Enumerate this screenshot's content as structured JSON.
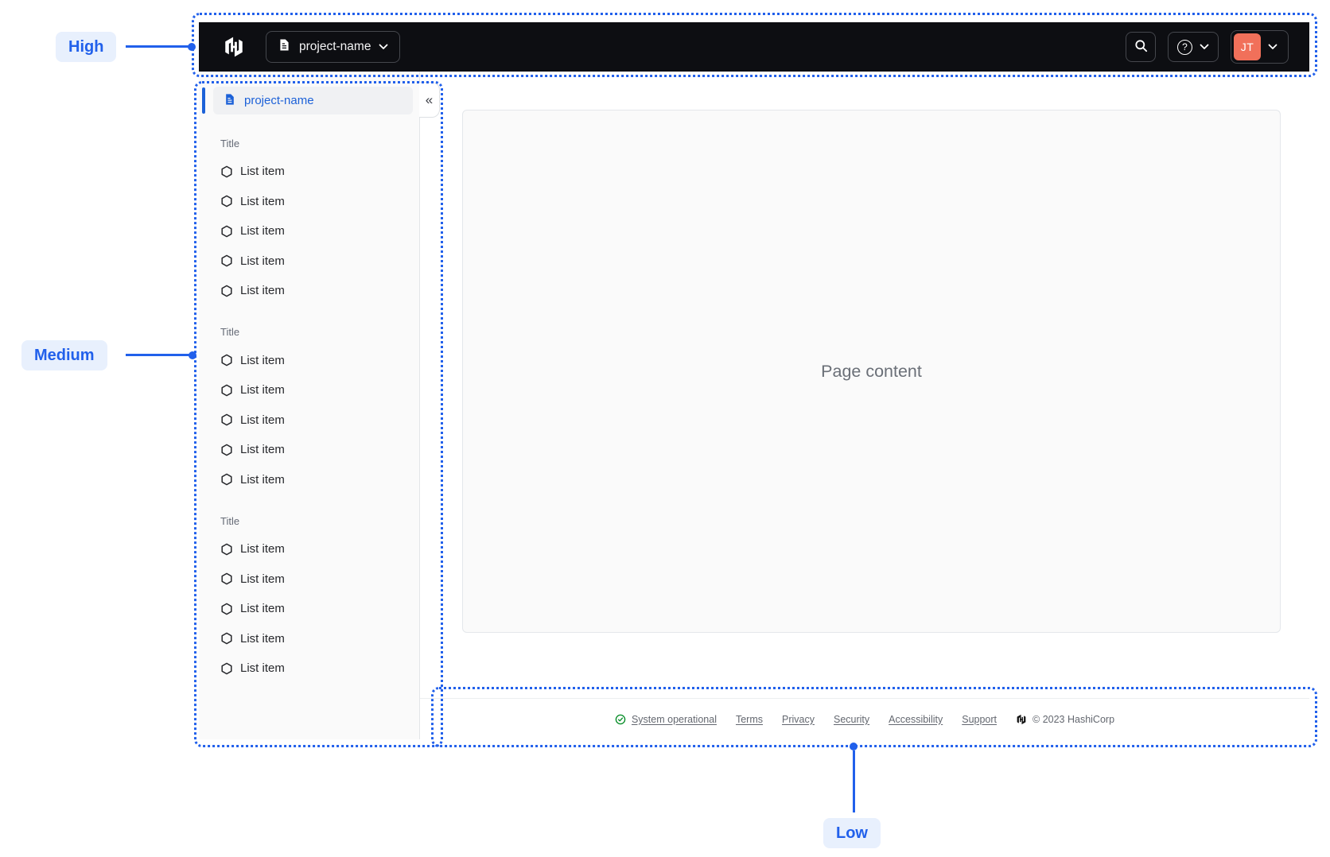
{
  "annotations": {
    "high": "High",
    "medium": "Medium",
    "low": "Low"
  },
  "navbar": {
    "project_selector_label": "project-name",
    "avatar_initials": "JT"
  },
  "sidebar": {
    "header_label": "project-name",
    "collapse_glyph": "«",
    "sections": [
      {
        "title": "Title",
        "items": [
          "List item",
          "List item",
          "List item",
          "List item",
          "List item"
        ]
      },
      {
        "title": "Title",
        "items": [
          "List item",
          "List item",
          "List item",
          "List item",
          "List item"
        ]
      },
      {
        "title": "Title",
        "items": [
          "List item",
          "List item",
          "List item",
          "List item",
          "List item"
        ]
      }
    ]
  },
  "main": {
    "placeholder": "Page content"
  },
  "footer": {
    "status_label": "System operational",
    "links": [
      "Terms",
      "Privacy",
      "Security",
      "Accessibility",
      "Support"
    ],
    "copyright": "© 2023 HashiCorp"
  },
  "colors": {
    "accent_blue": "#2160EB",
    "link_blue": "#1C61D8",
    "navbar_bg": "#0D0E12",
    "avatar_bg": "#F1705A",
    "success_green": "#008A22",
    "annotation_pill_bg": "#E8F0FD"
  }
}
